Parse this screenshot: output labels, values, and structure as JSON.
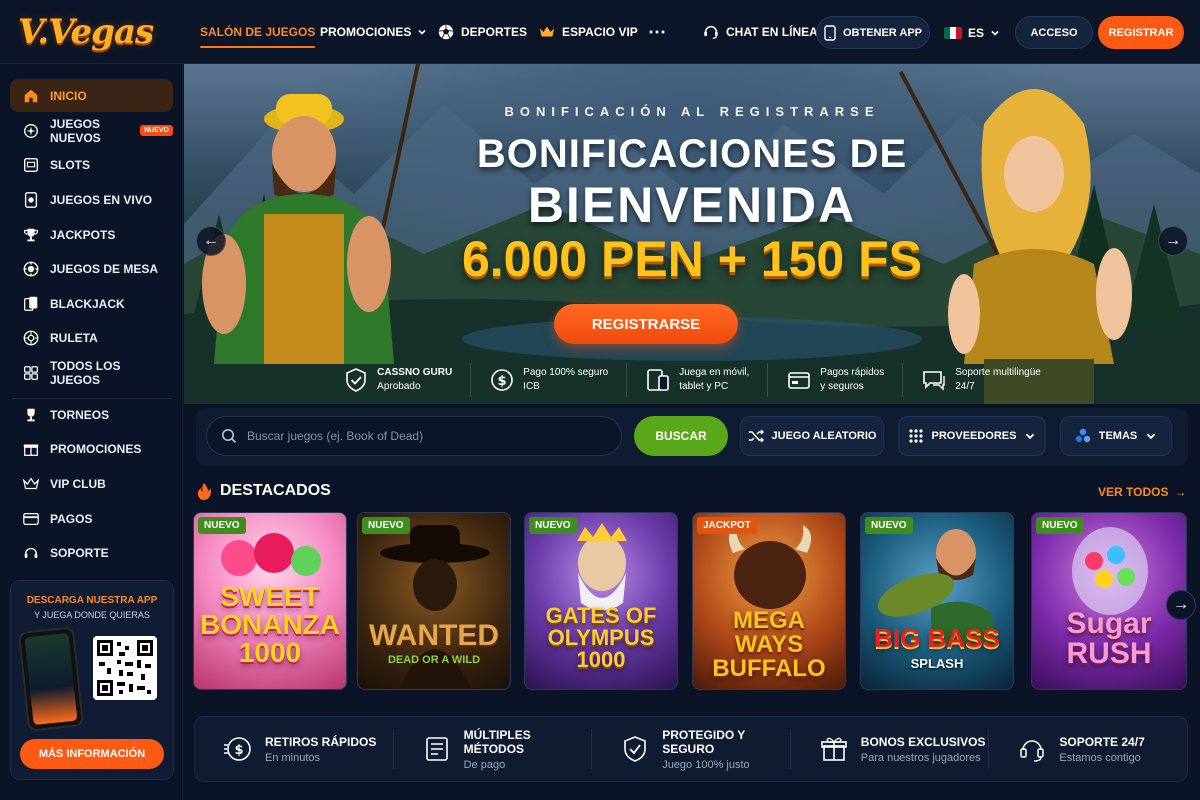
{
  "brand": {
    "logo_text": "V.Vegas"
  },
  "header": {
    "nav": [
      {
        "label": "Salón de juegos",
        "active": true
      },
      {
        "label": "Promociones",
        "has_dropdown": true
      },
      {
        "label": "Deportes",
        "icon": "soccer-ball-icon"
      },
      {
        "label": "Espacio VIP",
        "icon": "crown-icon"
      }
    ],
    "more_icon": "more-icon",
    "chat_label": "Chat en línea",
    "app_label": "Obtener App",
    "language": "ES",
    "login_label": "Acceso",
    "register_label": "Registrar"
  },
  "sidebar": {
    "items": [
      {
        "label": "Inicio",
        "icon": "home-icon",
        "active": true
      },
      {
        "label": "Juegos Nuevos",
        "icon": "sparkle-icon",
        "badge": "Nuevo"
      },
      {
        "label": "Slots",
        "icon": "slot-machine-icon"
      },
      {
        "label": "Juegos en vivo",
        "icon": "live-icon"
      },
      {
        "label": "Jackpots",
        "icon": "trophy-icon"
      },
      {
        "label": "Juegos de mesa",
        "icon": "chip-icon"
      },
      {
        "label": "Blackjack",
        "icon": "cards-icon"
      },
      {
        "label": "Ruleta",
        "icon": "roulette-icon"
      },
      {
        "label": "Todos los juegos",
        "icon": "grid-icon"
      },
      {
        "label": "Torneos",
        "icon": "cup-icon"
      },
      {
        "label": "Promociones",
        "icon": "gift-icon"
      },
      {
        "label": "VIP Club",
        "icon": "crown-icon"
      },
      {
        "label": "Pagos",
        "icon": "card-icon"
      },
      {
        "label": "Soporte",
        "icon": "headset-icon"
      }
    ],
    "app_promo": {
      "title": "Descarga nuestra app",
      "subtitle": "y juega donde quieras",
      "button": "Más información"
    }
  },
  "hero": {
    "eyebrow": "Bonificación al registrarse",
    "title_line1": "Bonificaciones de",
    "title_line2": "Bienvenida",
    "offer": "6.000 PEN + 150 FS",
    "cta": "Registrarse",
    "features": [
      {
        "line1": "CASSNO GURU",
        "line2": "Aprobado",
        "icon": "shield-check-icon"
      },
      {
        "line1": "Pago 100% seguro",
        "line2": "ICB",
        "icon": "dollar-icon"
      },
      {
        "line1": "Juega en móvil,",
        "line2": "tablet y PC",
        "icon": "devices-icon"
      },
      {
        "line1": "Pagos rápidos",
        "line2": "y seguros",
        "icon": "wallet-icon"
      },
      {
        "line1": "Soporte multilingüe",
        "line2": "24/7",
        "icon": "chat-icon"
      }
    ]
  },
  "search": {
    "placeholder": "Buscar juegos (ej. Book of Dead)",
    "button": "Buscar",
    "random_label": "Juego aleatorio",
    "providers_label": "Proveedores",
    "themes_label": "Temas"
  },
  "featured": {
    "title": "Destacados",
    "see_all": "Ver todos",
    "games": [
      {
        "tag": "Nuevo",
        "title": "SWEET BONANZA 1000"
      },
      {
        "tag": "Nuevo",
        "title": "WANTED",
        "subtitle": "DEAD OR A WILD"
      },
      {
        "tag": "Nuevo",
        "title": "GATES OF OLYMPUS 1000"
      },
      {
        "tag": "Jackpot",
        "title": "MEGA WAYS BUFFALO"
      },
      {
        "tag": "Nuevo",
        "title": "BIG BASS",
        "subtitle": "SPLASH"
      },
      {
        "tag": "Nuevo",
        "title": "Sugar RUSH"
      }
    ]
  },
  "benefits": [
    {
      "title": "Retiros rápidos",
      "subtitle": "En minutos",
      "icon": "fast-money-icon"
    },
    {
      "title": "Múltiples métodos",
      "subtitle": "De pago",
      "icon": "receipt-icon"
    },
    {
      "title": "Protegido y seguro",
      "subtitle": "Juego 100% justo",
      "icon": "shield-check-icon"
    },
    {
      "title": "Bonos exclusivos",
      "subtitle": "Para nuestros jugadores",
      "icon": "gift-icon"
    },
    {
      "title": "Soporte 24/7",
      "subtitle": "Estamos contigo",
      "icon": "headset-icon"
    }
  ],
  "colors": {
    "accent": "#ff5a14",
    "accent_text": "#ff8a1c",
    "gold": "#ffc21a",
    "success": "#58a81a",
    "bg": "#0a1426"
  }
}
